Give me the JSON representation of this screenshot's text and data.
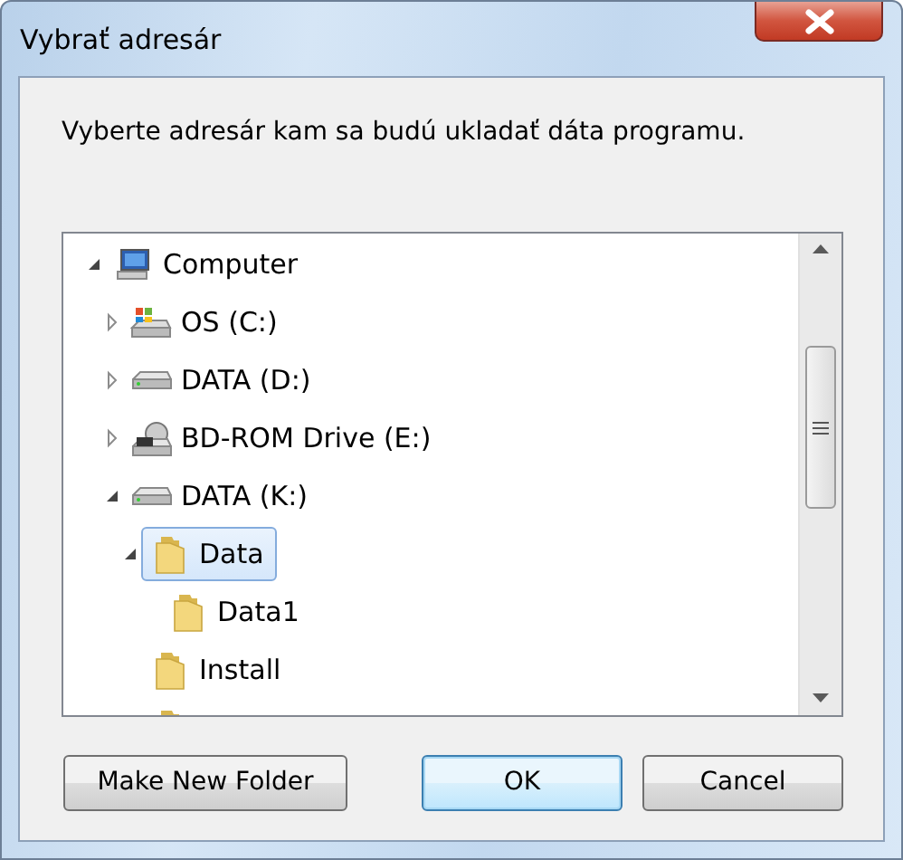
{
  "window": {
    "title": "Vybrať adresár"
  },
  "instruction": "Vyberte adresár kam sa budú ukladať dáta programu.",
  "tree": [
    {
      "label": "Computer",
      "kind": "computer",
      "expanded": true,
      "selected": false,
      "children": [
        {
          "label": "OS (C:)",
          "kind": "system-drive",
          "expanded": false,
          "selected": false
        },
        {
          "label": "DATA (D:)",
          "kind": "drive",
          "expanded": false,
          "selected": false
        },
        {
          "label": "BD-ROM Drive (E:)",
          "kind": "optical-drive",
          "expanded": false,
          "selected": false
        },
        {
          "label": "DATA (K:)",
          "kind": "drive",
          "expanded": true,
          "selected": false,
          "children": [
            {
              "label": "Data",
              "kind": "folder",
              "expanded": true,
              "selected": true,
              "children": [
                {
                  "label": "Data1",
                  "kind": "folder",
                  "selected": false
                }
              ]
            },
            {
              "label": "Install",
              "kind": "folder",
              "selected": false
            },
            {
              "kind": "folder",
              "selected": false
            }
          ]
        }
      ]
    }
  ],
  "buttons": [
    {
      "label": "Make New Folder",
      "default": false
    },
    {
      "label": "OK",
      "default": true
    },
    {
      "label": "Cancel",
      "default": false
    }
  ]
}
